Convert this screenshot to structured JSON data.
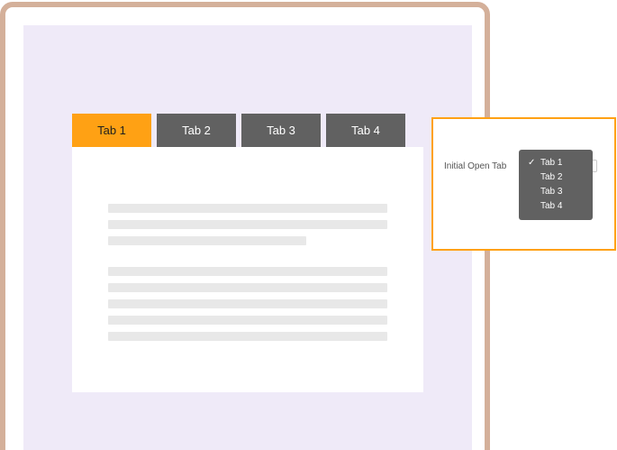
{
  "tabs": [
    {
      "label": "Tab 1",
      "active": true
    },
    {
      "label": "Tab 2",
      "active": false
    },
    {
      "label": "Tab 3",
      "active": false
    },
    {
      "label": "Tab 4",
      "active": false
    }
  ],
  "settings": {
    "initial_open_tab_label": "Initial Open Tab",
    "selected_value": "Tab 1",
    "options": [
      "Tab 1",
      "Tab 2",
      "Tab 3",
      "Tab 4"
    ],
    "selected_icon": "check-icon"
  },
  "colors": {
    "frame": "#d4b09a",
    "canvas": "#efeaf8",
    "active_tab": "#ffa114",
    "inactive_tab": "#616161",
    "popover_border": "#ffa114",
    "dropdown_bg": "#616161"
  }
}
